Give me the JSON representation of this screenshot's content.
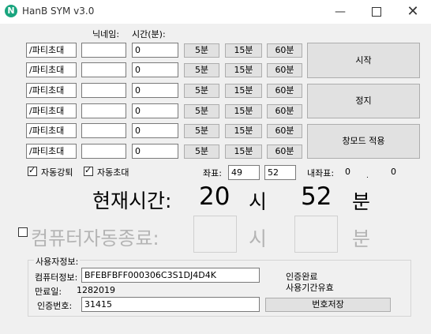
{
  "window": {
    "title": "HanB SYM v3.0",
    "icon_letter": "N",
    "controls": [
      "minimize-icon",
      "maximize-icon",
      "close-icon"
    ]
  },
  "headers": {
    "nickname": "닉네임:",
    "time": "시간(분):"
  },
  "rows": [
    {
      "command": "/파티초대",
      "nickname": "",
      "minutes": "0",
      "b5": "5분",
      "b15": "15분",
      "b60": "60분"
    },
    {
      "command": "/파티초대",
      "nickname": "",
      "minutes": "0",
      "b5": "5분",
      "b15": "15분",
      "b60": "60분"
    },
    {
      "command": "/파티초대",
      "nickname": "",
      "minutes": "0",
      "b5": "5분",
      "b15": "15분",
      "b60": "60분"
    },
    {
      "command": "/파티초대",
      "nickname": "",
      "minutes": "0",
      "b5": "5분",
      "b15": "15분",
      "b60": "60분"
    },
    {
      "command": "/파티초대",
      "nickname": "",
      "minutes": "0",
      "b5": "5분",
      "b15": "15분",
      "b60": "60분"
    },
    {
      "command": "/파티초대",
      "nickname": "",
      "minutes": "0",
      "b5": "5분",
      "b15": "15분",
      "b60": "60분"
    }
  ],
  "actions": {
    "start": "시작",
    "stop": "정지",
    "window_mode": "창모드 적용"
  },
  "options": {
    "auto_kick": {
      "label": "자동강퇴",
      "checked": true
    },
    "auto_invite": {
      "label": "자동초대",
      "checked": true
    }
  },
  "coords": {
    "label": "좌표:",
    "x": "49",
    "y": "52",
    "internal_label": "내좌표:",
    "internal_x": "0",
    "internal_y": "0"
  },
  "current_time": {
    "label": "현재시간:",
    "hour": "20",
    "hour_unit": "시",
    "minute": "52",
    "minute_unit": "분"
  },
  "auto_shutdown": {
    "label": "컴퓨터자동종료:",
    "checked": false,
    "hour_unit": "시",
    "minute_unit": "분"
  },
  "user_info": {
    "group_title": "사용자정보:",
    "computer_label": "컴퓨터정보:",
    "computer_value": "BFEBFBFF000306C3S1DJ4D4K",
    "expiry_label": "만료일:",
    "expiry_value": "1282019",
    "auth_label": "인증번호:",
    "auth_value": "31415",
    "status_line1": "인증완료",
    "status_line2": "사용기간유효",
    "save_button": "번호저장"
  },
  "colors": {
    "accent": "#1aa57f",
    "button": "#e1e1e1",
    "window_bg": "#f0f0f0"
  }
}
